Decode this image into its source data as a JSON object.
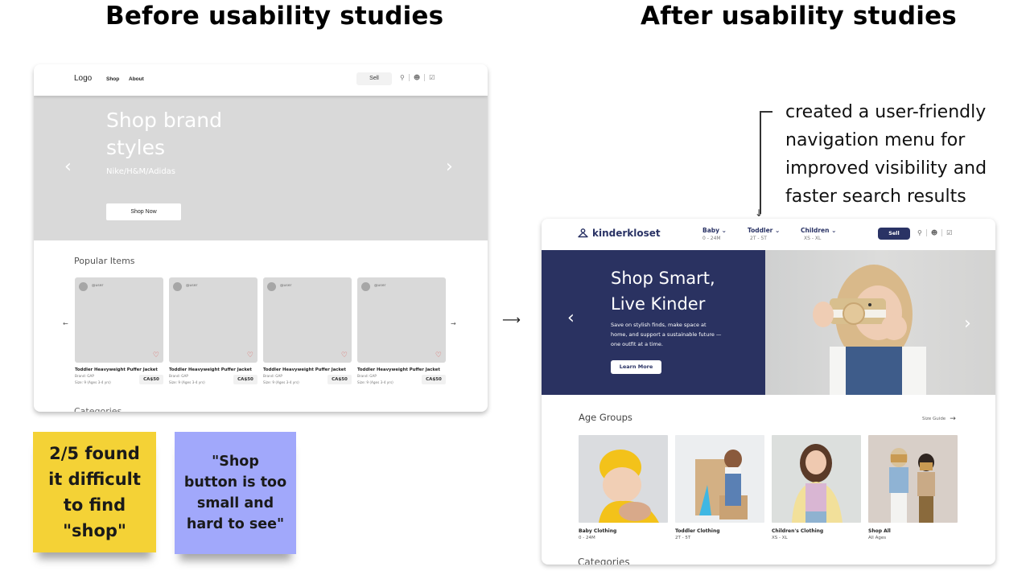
{
  "headings": {
    "before": "Before usability studies",
    "after": "After usability studies"
  },
  "before_mock": {
    "nav": {
      "logo": "Logo",
      "links": [
        "Shop",
        "About"
      ],
      "sell_label": "Sell",
      "icons": [
        "search-icon",
        "user-icon",
        "basket-icon"
      ]
    },
    "hero": {
      "title": "Shop brand styles",
      "subtitle": "Nike/H&M/Adidas",
      "button_label": "Shop Now",
      "prev_icon": "‹",
      "next_icon": "›"
    },
    "popular": {
      "title": "Popular Items",
      "prev_arrow": "←",
      "next_arrow": "→",
      "items": [
        {
          "user": "@user",
          "name": "Toddler Heavyweight Puffer Jacket",
          "brand": "Brand: GAP",
          "size": "Size: 9 (Ages 3-4 yrs)",
          "price": "CA$50"
        },
        {
          "user": "@user",
          "name": "Toddler Heavyweight Puffer Jacket",
          "brand": "Brand: GAP",
          "size": "Size: 9 (Ages 3-4 yrs)",
          "price": "CA$50"
        },
        {
          "user": "@user",
          "name": "Toddler Heavyweight Puffer Jacket",
          "brand": "Brand: GAP",
          "size": "Size: 9 (Ages 3-4 yrs)",
          "price": "CA$50"
        },
        {
          "user": "@user",
          "name": "Toddler Heavyweight Puffer Jacket",
          "brand": "Brand: GAP",
          "size": "Size: 9 (Ages 3-4 yrs)",
          "price": "CA$50"
        }
      ]
    },
    "categories_peek": "Categories"
  },
  "notes": {
    "yellow": "2/5 found it difficult to find \"shop\"",
    "blue": "\"Shop button is too small and hard to see\"",
    "colors": {
      "yellow": "#f4d236",
      "blue": "#a1a8fb"
    }
  },
  "transition_arrow": "⟶",
  "annotation": {
    "lines": [
      "created a user-friendly",
      "navigation menu for",
      "improved visibility and",
      "faster search results"
    ]
  },
  "after_mock": {
    "brand_color": "#2a3365",
    "nav": {
      "logo": "kinderkloset",
      "menus": [
        {
          "label": "Baby",
          "sub": "0 - 24M"
        },
        {
          "label": "Toddler",
          "sub": "2T - 5T"
        },
        {
          "label": "Children",
          "sub": "XS - XL"
        }
      ],
      "sell_label": "Sell",
      "icons": [
        "search-icon",
        "user-icon",
        "basket-icon"
      ]
    },
    "hero": {
      "title_line1": "Shop Smart,",
      "title_line2": "Live Kinder",
      "description": "Save on stylish finds, make space at home, and support a sustainable future — one outfit at a time.",
      "button_label": "Learn More",
      "prev_icon": "‹",
      "next_icon": "›"
    },
    "age_groups": {
      "title": "Age Groups",
      "size_guide_label": "Size Guide",
      "items": [
        {
          "label": "Baby Clothing",
          "sub": "0 - 24M"
        },
        {
          "label": "Toddler Clothing",
          "sub": "2T - 5T"
        },
        {
          "label": "Children's Clothing",
          "sub": "XS - XL"
        },
        {
          "label": "Shop All",
          "sub": "All Ages"
        }
      ]
    },
    "categories_peek": "Categories"
  }
}
